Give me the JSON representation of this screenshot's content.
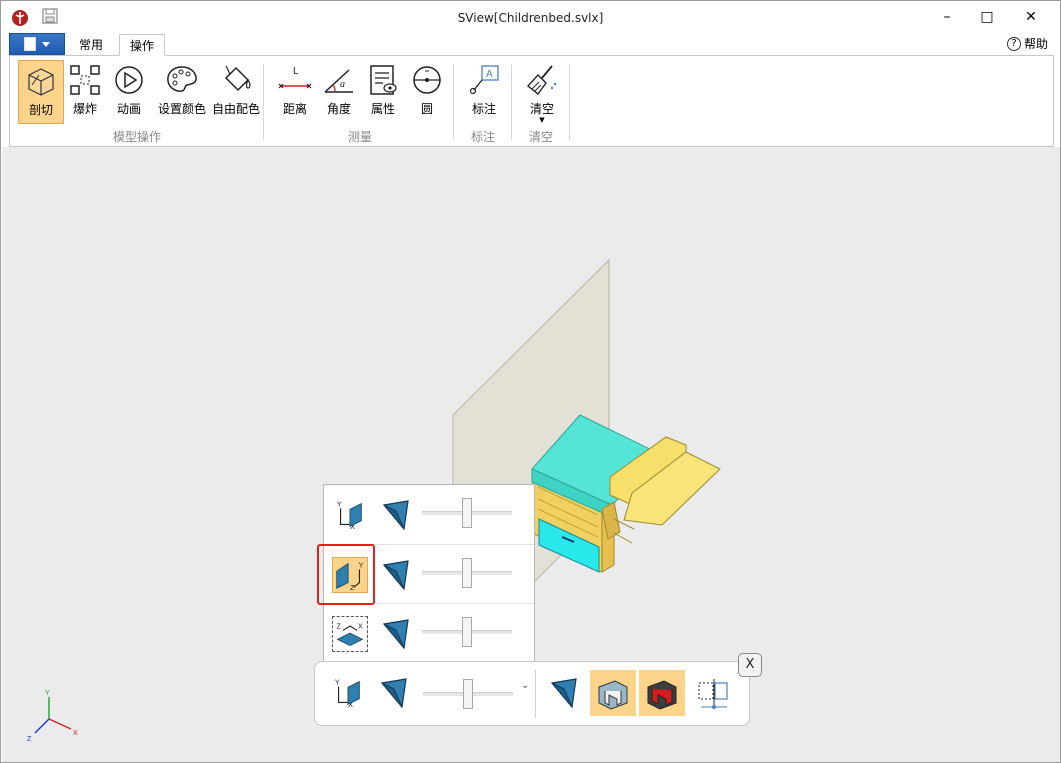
{
  "window": {
    "title": "SView[Childrenbed.svlx]",
    "minimize_symbol": "–",
    "maximize_symbol": "□",
    "close_symbol": "✕"
  },
  "tabs": [
    {
      "label": "常用",
      "active": false
    },
    {
      "label": "操作",
      "active": true
    }
  ],
  "help": {
    "label": "帮助",
    "symbol": "?"
  },
  "ribbon": {
    "groups": [
      {
        "label": "模型操作",
        "buttons": [
          {
            "label": "剖切",
            "icon": "section-cut-icon",
            "active": true
          },
          {
            "label": "爆炸",
            "icon": "explode-icon"
          },
          {
            "label": "动画",
            "icon": "play-icon"
          },
          {
            "label": "设置颜色",
            "icon": "palette-icon"
          },
          {
            "label": "自由配色",
            "icon": "paint-bucket-icon"
          }
        ]
      },
      {
        "label": "测量",
        "buttons": [
          {
            "label": "距离",
            "icon": "distance-icon",
            "glyph": "L"
          },
          {
            "label": "角度",
            "icon": "angle-icon",
            "glyph": "a"
          },
          {
            "label": "属性",
            "icon": "properties-icon"
          },
          {
            "label": "圆",
            "icon": "circle-measure-icon"
          }
        ]
      },
      {
        "label": "标注",
        "buttons": [
          {
            "label": "标注",
            "icon": "annotation-icon",
            "glyph": "A"
          }
        ]
      },
      {
        "label": "清空",
        "buttons": [
          {
            "label": "清空",
            "icon": "broom-icon",
            "dropdown": true
          }
        ]
      }
    ]
  },
  "plane_popup": {
    "rows": [
      {
        "plane": "XY",
        "axis_labels": [
          "Y",
          "X"
        ],
        "active": false,
        "slider": 0.5
      },
      {
        "plane": "YZ",
        "axis_labels": [
          "Y",
          "Z"
        ],
        "active": true,
        "slider": 0.5
      },
      {
        "plane": "XZ",
        "axis_labels": [
          "Z",
          "X"
        ],
        "active": false,
        "slider": 0.5
      }
    ]
  },
  "section_toolbar": {
    "plane_axis_labels": [
      "Y",
      "X"
    ],
    "slider": 0.5,
    "dropdown_symbol": "⌄",
    "close_label": "X"
  },
  "axis_triad": {
    "labels": [
      "Y",
      "Z",
      "X"
    ]
  },
  "colors": {
    "accent_active": "#fbd38a",
    "highlight_border": "#e0201a",
    "model_cyan": "#55e5d6",
    "model_yellow": "#f6df6a",
    "icon_blue": "#2f7fb0"
  }
}
